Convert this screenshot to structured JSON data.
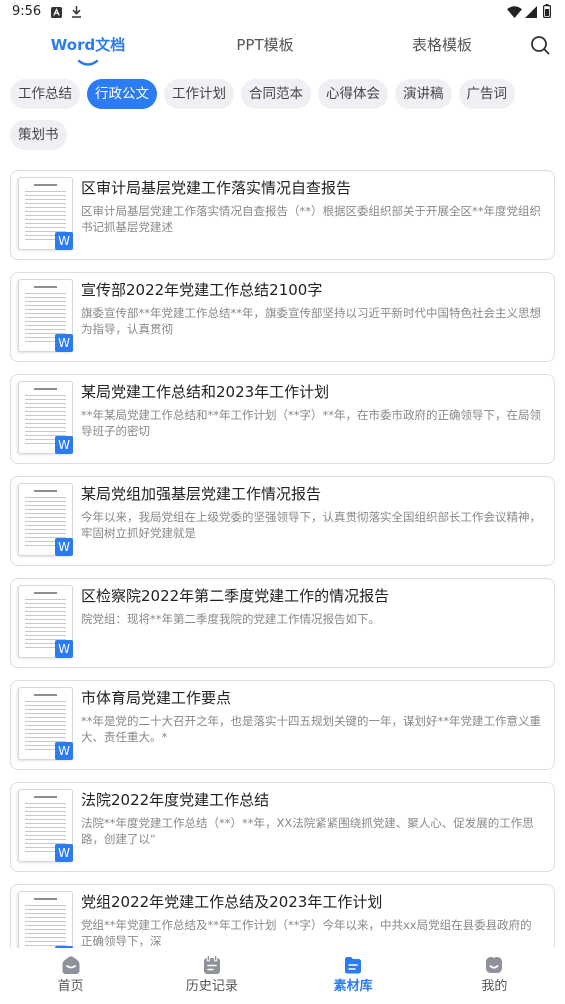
{
  "status_bar": {
    "time": "9:56",
    "left_icons": [
      "app-notification-icon",
      "download-icon"
    ],
    "right_icons": [
      "wifi-icon",
      "signal-icon",
      "battery-icon"
    ]
  },
  "header": {
    "tabs": [
      {
        "label": "Word文档",
        "active": true
      },
      {
        "label": "PPT模板",
        "active": false
      },
      {
        "label": "表格模板",
        "active": false
      }
    ],
    "search_icon": "search-icon"
  },
  "categories": [
    {
      "label": "工作总结",
      "active": false
    },
    {
      "label": "行政公文",
      "active": true
    },
    {
      "label": "工作计划",
      "active": false
    },
    {
      "label": "合同范本",
      "active": false
    },
    {
      "label": "心得体会",
      "active": false
    },
    {
      "label": "演讲稿",
      "active": false
    },
    {
      "label": "广告词",
      "active": false
    },
    {
      "label": "策划书",
      "active": false
    }
  ],
  "documents": [
    {
      "title": "区审计局基层党建工作落实情况自查报告",
      "snippet": "区审计局基层党建工作落实情况自查报告（**）根据区委组织部关于开展全区**年度党组织书记抓基层党建述",
      "badge": "W"
    },
    {
      "title": "宣传部2022年党建工作总结2100字",
      "snippet": "旗委宣传部**年党建工作总结**年，旗委宣传部坚持以习近平新时代中国特色社会主义思想为指导，认真贯彻",
      "badge": "W"
    },
    {
      "title": "某局党建工作总结和2023年工作计划",
      "snippet": "**年某局党建工作总结和**年工作计划（**字）**年，在市委市政府的正确领导下，在局领导班子的密切",
      "badge": "W"
    },
    {
      "title": "某局党组加强基层党建工作情况报告",
      "snippet": "今年以来，我局党组在上级党委的坚强领导下，认真贯彻落实全国组织部长工作会议精神，牢固树立抓好党建就是",
      "badge": "W"
    },
    {
      "title": "区检察院2022年第二季度党建工作的情况报告",
      "snippet": "院党组：现将**年第二季度我院的党建工作情况报告如下。",
      "badge": "W"
    },
    {
      "title": "市体育局党建工作要点",
      "snippet": "**年是党的二十大召开之年，也是落实十四五规划关键的一年，谋划好**年党建工作意义重大、责任重大。*",
      "badge": "W"
    },
    {
      "title": "法院2022年度党建工作总结",
      "snippet": "法院**年度党建工作总结（**）**年，XX法院紧紧围绕抓党建、聚人心、促发展的工作思路，创建了以“",
      "badge": "W"
    },
    {
      "title": "党组2022年党建工作总结及2023年工作计划",
      "snippet": "党组**年党建工作总结及**年工作计划（**字）今年以来，中共xx局党组在县委县政府的正确领导下，深",
      "badge": "W"
    }
  ],
  "bottom_nav": [
    {
      "label": "首页",
      "icon": "home-icon",
      "active": false
    },
    {
      "label": "历史记录",
      "icon": "history-icon",
      "active": false
    },
    {
      "label": "素材库",
      "icon": "library-icon",
      "active": true
    },
    {
      "label": "我的",
      "icon": "profile-icon",
      "active": false
    }
  ],
  "colors": {
    "accent": "#2b7cf2",
    "chip_bg": "#eef0f4",
    "text_primary": "#222222",
    "text_secondary": "#888888",
    "nav_inactive": "#8d929b"
  }
}
